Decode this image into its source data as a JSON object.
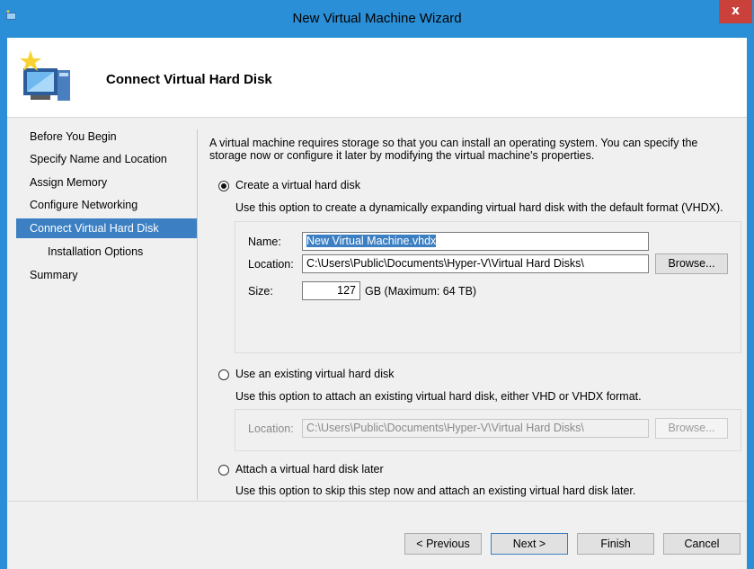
{
  "window": {
    "title": "New Virtual Machine Wizard",
    "close_glyph": "x",
    "accent": "#2a8fd6",
    "close_color": "#c9413a"
  },
  "header": {
    "title": "Connect Virtual Hard Disk",
    "icon": "new-vm-monitor-icon"
  },
  "nav": {
    "items": [
      {
        "label": "Before You Begin"
      },
      {
        "label": "Specify Name and Location"
      },
      {
        "label": "Assign Memory"
      },
      {
        "label": "Configure Networking"
      },
      {
        "label": "Connect Virtual Hard Disk",
        "selected": true
      },
      {
        "label": "Installation Options"
      },
      {
        "label": "Summary"
      }
    ],
    "selected_color": "#3c7fc2"
  },
  "main": {
    "intro": "A virtual machine requires storage so that you can install an operating system. You can specify the storage now or configure it later by modifying the virtual machine's properties.",
    "intro_line1": "A virtual machine requires storage so that you can install an operating system. You can specify the",
    "intro_line2": "storage now or configure it later by modifying the virtual machine's properties.",
    "option_create": {
      "label": "Create a virtual hard disk",
      "selected": true,
      "description": "Use this option to create a dynamically expanding virtual hard disk with the default format (VHDX).",
      "name_label": "Name:",
      "name_value": "New Virtual Machine.vhdx",
      "location_label": "Location:",
      "location_value": "C:\\Users\\Public\\Documents\\Hyper-V\\Virtual Hard Disks\\",
      "browse_label": "Browse...",
      "size_label": "Size:",
      "size_value": "127",
      "size_unit": "GB (Maximum: 64 TB)"
    },
    "option_existing": {
      "label": "Use an existing virtual hard disk",
      "selected": false,
      "description": "Use this option to attach an existing virtual hard disk, either VHD or VHDX format.",
      "location_label": "Location:",
      "location_value": "C:\\Users\\Public\\Documents\\Hyper-V\\Virtual Hard Disks\\",
      "browse_label": "Browse..."
    },
    "option_later": {
      "label": "Attach a virtual hard disk later",
      "selected": false,
      "description": "Use this option to skip this step now and attach an existing virtual hard disk later."
    }
  },
  "footer": {
    "previous_label": "< Previous",
    "next_label": "Next >",
    "finish_label": "Finish",
    "cancel_label": "Cancel"
  }
}
